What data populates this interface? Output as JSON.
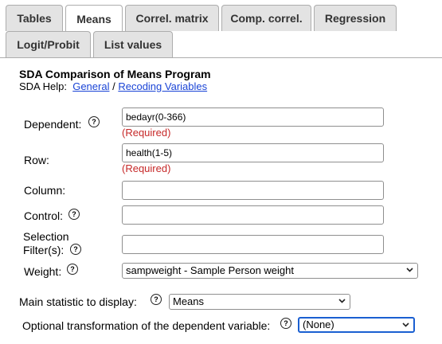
{
  "tabs": {
    "row1": [
      "Tables",
      "Means",
      "Correl. matrix",
      "Comp. correl.",
      "Regression"
    ],
    "row2": [
      "Logit/Probit",
      "List values"
    ],
    "active": "Means"
  },
  "header": {
    "title": "SDA Comparison of Means Program",
    "help_prefix": "SDA Help:",
    "help_general": "General",
    "help_sep": "/",
    "help_recoding": "Recoding Variables"
  },
  "form": {
    "dependent": {
      "label": "Dependent:",
      "value": "bedayr(0-366)",
      "note": "(Required)"
    },
    "row": {
      "label": "Row:",
      "value": "health(1-5)",
      "note": "(Required)"
    },
    "column": {
      "label": "Column:",
      "value": ""
    },
    "control": {
      "label": "Control:",
      "value": ""
    },
    "filter": {
      "label_line1": "Selection",
      "label_line2": "Filter(s):",
      "value": ""
    },
    "weight": {
      "label": "Weight:",
      "selected": "sampweight - Sample Person weight"
    },
    "main_statistic": {
      "label": "Main statistic to display:",
      "selected": "Means"
    },
    "transformation": {
      "label": "Optional transformation of the dependent variable:",
      "selected": "(None)"
    }
  },
  "icons": {
    "help": "question-circle-icon",
    "dropdown": "chevron-down-icon"
  },
  "colors": {
    "link": "#1a44d6",
    "required": "#c62828",
    "tab_bg": "#e3e3e3",
    "focus": "#1a5fd1"
  }
}
